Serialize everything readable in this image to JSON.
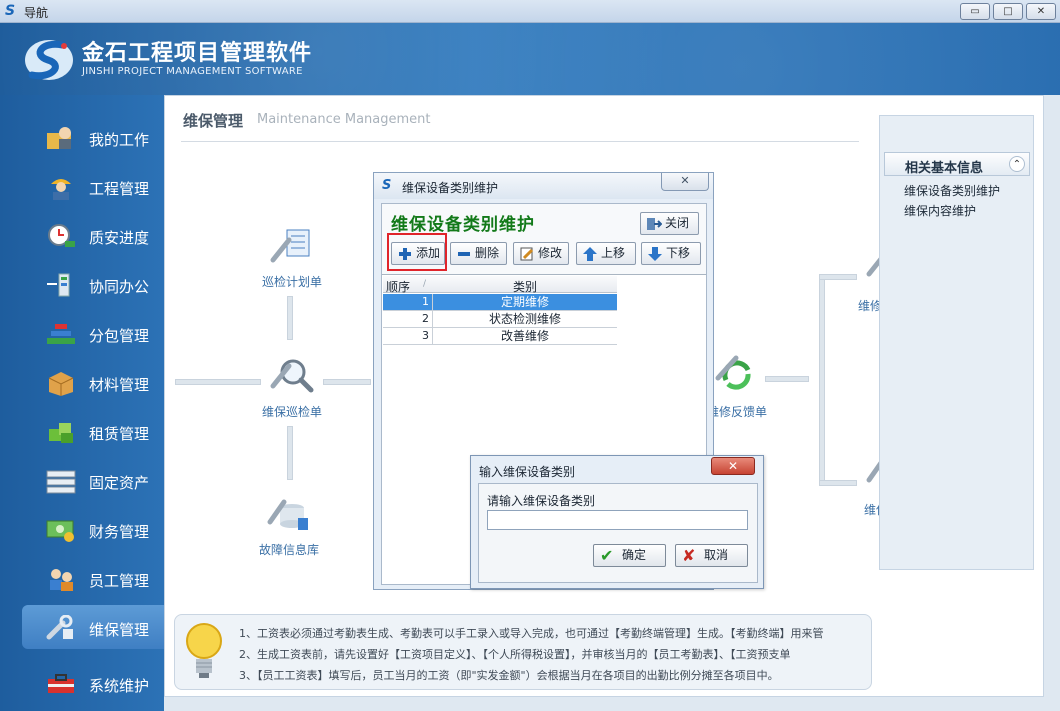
{
  "window": {
    "title": "导航",
    "minimize": "▭",
    "maximize": "□",
    "close": "✕"
  },
  "header": {
    "title": "金石工程项目管理软件",
    "subtitle": "JINSHI PROJECT MANAGEMENT SOFTWARE"
  },
  "sidebar": {
    "items": [
      {
        "label": "我的工作",
        "icon": "worker-icon"
      },
      {
        "label": "工程管理",
        "icon": "engineer-icon"
      },
      {
        "label": "质安进度",
        "icon": "clock-icon"
      },
      {
        "label": "协同办公",
        "icon": "network-icon"
      },
      {
        "label": "分包管理",
        "icon": "pyramid-icon"
      },
      {
        "label": "材料管理",
        "icon": "box-icon"
      },
      {
        "label": "租赁管理",
        "icon": "cubes-icon"
      },
      {
        "label": "固定资产",
        "icon": "server-icon"
      },
      {
        "label": "财务管理",
        "icon": "money-icon"
      },
      {
        "label": "员工管理",
        "icon": "users-icon"
      },
      {
        "label": "维保管理",
        "icon": "wrench-icon"
      },
      {
        "label": "系统维护",
        "icon": "toolbox-icon"
      }
    ],
    "active_index": 10
  },
  "main": {
    "title": "维保管理",
    "subtitle": "Maintenance Management",
    "flow": {
      "inspection_plan": "巡检计划单",
      "inspection_order": "维保巡检单",
      "fault_db": "故障信息库",
      "feedback": "维修反馈单",
      "evaluation": "维修评价单",
      "statistics": "维保统计"
    }
  },
  "right_panel": {
    "heading": "相关基本信息",
    "links": [
      "维保设备类别维护",
      "维保内容维护"
    ]
  },
  "tips": {
    "lines": [
      "1、工资表必须通过考勤表生成、考勤表可以手工录入或导入完成，也可通过【考勤终端管理】生成。【考勤终端】用来管",
      "2、生成工资表前，请先设置好【工资项目定义】、【个人所得税设置】，并审核当月的【员工考勤表】、【工资预支单",
      "3、【员工工资表】填写后，员工当月的工资（即\"实发金额\"）会根据当月在各项目的出勤比例分摊至各项目中。"
    ]
  },
  "dialog_category": {
    "window_title": "维保设备类别维护",
    "heading": "维保设备类别维护",
    "close_label": "关闭",
    "toolbar": {
      "add": "添加",
      "delete": "删除",
      "edit": "修改",
      "move_up": "上移",
      "move_down": "下移"
    },
    "columns": [
      "顺序",
      "类别"
    ],
    "rows": [
      {
        "order": "1",
        "category": "定期维修"
      },
      {
        "order": "2",
        "category": "状态检测维修"
      },
      {
        "order": "3",
        "category": "改善维修"
      }
    ],
    "selected_row": 0
  },
  "dialog_input": {
    "title": "输入维保设备类别",
    "prompt": "请输入维保设备类别",
    "value": "",
    "ok_label": "确定",
    "cancel_label": "取消"
  },
  "colors": {
    "brand_blue": "#2a6eb1",
    "heading_green": "#137a1a",
    "selection_blue": "#3b8fe0",
    "highlight_red": "#e0242a"
  }
}
